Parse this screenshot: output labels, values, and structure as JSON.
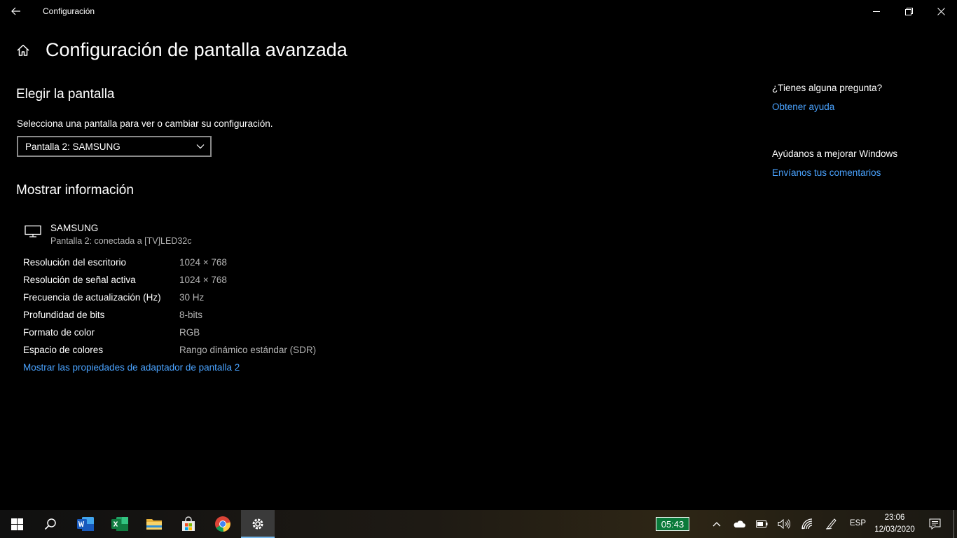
{
  "window": {
    "title": "Configuración"
  },
  "page": {
    "title": "Configuración de pantalla avanzada",
    "choose_heading": "Elegir la pantalla",
    "choose_desc": "Selecciona una pantalla para ver o cambiar su configuración.",
    "display_select": "Pantalla 2: SAMSUNG",
    "info_heading": "Mostrar información",
    "display_name": "SAMSUNG",
    "display_sub": "Pantalla 2: conectada a [TV]LED32c",
    "rows": [
      {
        "label": "Resolución del escritorio",
        "value": "1024 × 768"
      },
      {
        "label": "Resolución de señal activa",
        "value": "1024 × 768"
      },
      {
        "label": "Frecuencia de actualización (Hz)",
        "value": "30 Hz"
      },
      {
        "label": "Profundidad de bits",
        "value": "8-bits"
      },
      {
        "label": "Formato de color",
        "value": "RGB"
      },
      {
        "label": "Espacio de colores",
        "value": "Rango dinámico estándar (SDR)"
      }
    ],
    "adapter_link": "Mostrar las propiedades de adaptador de pantalla 2"
  },
  "sidebar": {
    "question": "¿Tienes alguna pregunta?",
    "help_link": "Obtener ayuda",
    "improve": "Ayúdanos a mejorar Windows",
    "feedback_link": "Envíanos tus comentarios"
  },
  "taskbar": {
    "timer": "05:43",
    "language": "ESP",
    "time": "23:06",
    "date": "12/03/2020",
    "apps": [
      "start-icon",
      "search-icon",
      "word-icon",
      "excel-icon",
      "file-explorer-icon",
      "store-icon",
      "chrome-icon",
      "settings-icon"
    ]
  },
  "colors": {
    "accent_link": "#4aa3ff",
    "background": "#000000",
    "secondary_text": "#b4b4b4"
  }
}
